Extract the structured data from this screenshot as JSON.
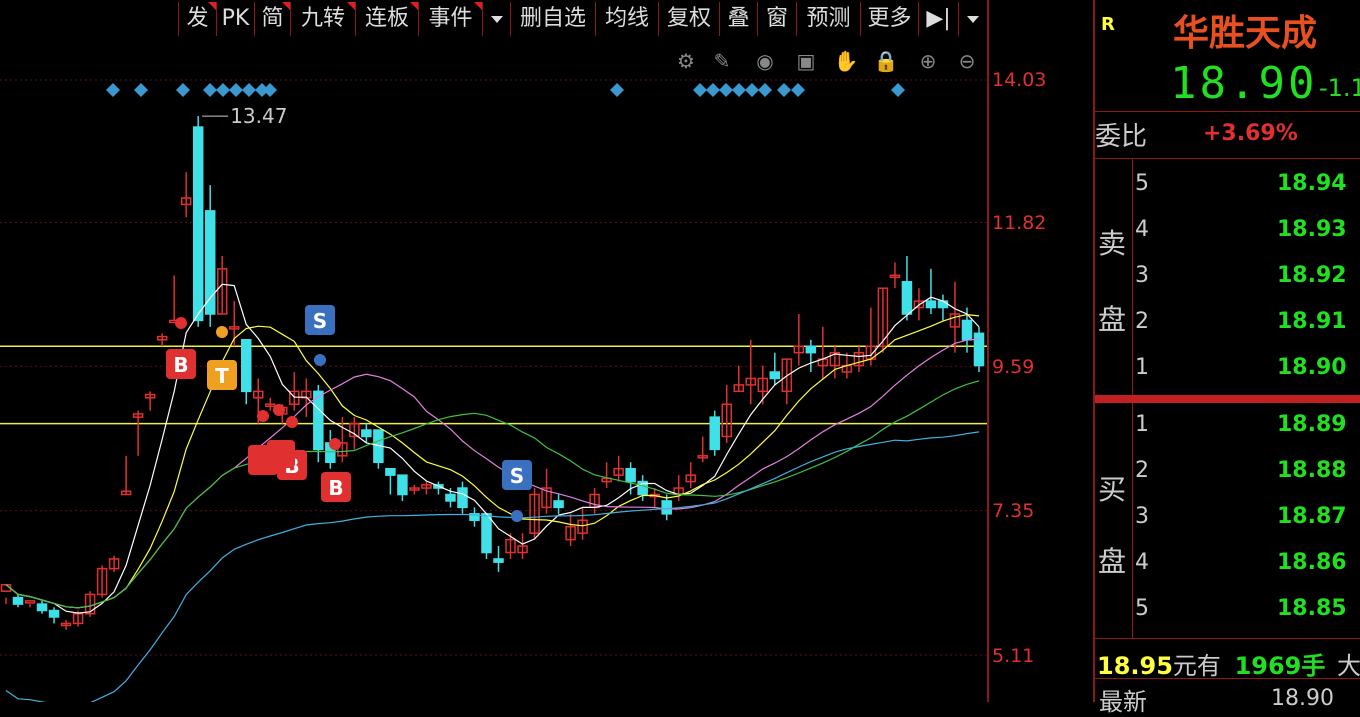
{
  "toolbar": {
    "buttons": [
      {
        "label": "发",
        "flag": true
      },
      {
        "label": "PK",
        "flag": false
      },
      {
        "label": "简",
        "flag": true
      },
      {
        "label": "九转",
        "flag": true
      },
      {
        "label": "连板",
        "flag": true
      },
      {
        "label": "事件",
        "flag": true
      },
      {
        "label": "",
        "dropdown": true
      },
      {
        "label": "删自选",
        "flag": false
      },
      {
        "label": "均线",
        "flag": false
      },
      {
        "label": "复权",
        "flag": false
      },
      {
        "label": "叠",
        "flag": false
      },
      {
        "label": "窗",
        "flag": false
      },
      {
        "label": "预测",
        "flag": false
      },
      {
        "label": "更多",
        "flag": false
      },
      {
        "label": "▶|",
        "flag": false
      },
      {
        "label": "",
        "dropdown": true
      }
    ]
  },
  "chart_controls": [
    "gear-icon",
    "pen-icon",
    "eye-icon",
    "toolbox-icon",
    "hand-icon",
    "lock-icon",
    "zoom-in-icon",
    "zoom-out-icon"
  ],
  "price_axis": [
    "14.03",
    "11.82",
    "9.59",
    "7.35",
    "5.11"
  ],
  "chart_data": {
    "type": "candlestick",
    "high_marker": "13.47",
    "price_range": [
      5.11,
      14.03
    ],
    "horizontal_lines": [
      9.9,
      8.7
    ],
    "signals": [
      {
        "label": "B",
        "color": "#e03030"
      },
      {
        "label": "T",
        "color": "#f0a020"
      },
      {
        "label": "S",
        "color": "#3a70c0"
      },
      {
        "label": "B",
        "color": "#e03030"
      },
      {
        "label": "B",
        "color": "#e03030"
      },
      {
        "label": "B",
        "color": "#e03030"
      },
      {
        "label": "S",
        "color": "#3a70c0"
      }
    ]
  },
  "quote": {
    "r_badge": "R",
    "stock_name": "华胜天成",
    "price": "18.90",
    "change": "-1.1",
    "weibi_label": "委比",
    "weibi_value": "+3.69%",
    "sell_label_1": "卖",
    "sell_label_2": "盘",
    "buy_label_1": "买",
    "buy_label_2": "盘",
    "sell": [
      {
        "lvl": "5",
        "price": "18.94"
      },
      {
        "lvl": "4",
        "price": "18.93"
      },
      {
        "lvl": "3",
        "price": "18.92"
      },
      {
        "lvl": "2",
        "price": "18.91"
      },
      {
        "lvl": "1",
        "price": "18.90"
      }
    ],
    "buy": [
      {
        "lvl": "1",
        "price": "18.89"
      },
      {
        "lvl": "2",
        "price": "18.88"
      },
      {
        "lvl": "3",
        "price": "18.87"
      },
      {
        "lvl": "4",
        "price": "18.86"
      },
      {
        "lvl": "5",
        "price": "18.85"
      }
    ],
    "footer_price": "18.95",
    "footer_unit": "元有",
    "footer_vol": "1969手",
    "footer_tail": "大",
    "latest_label": "最新",
    "latest_value": "18.90"
  },
  "colors": {
    "up": "#e03030",
    "down": "#40e0e8",
    "ma5": "#ffffff",
    "ma10": "#ffff40",
    "ma20": "#e080e0",
    "ma30": "#40c040",
    "ma60": "#40b0e0",
    "bid_price": "#20e020",
    "accent": "#e03030"
  }
}
